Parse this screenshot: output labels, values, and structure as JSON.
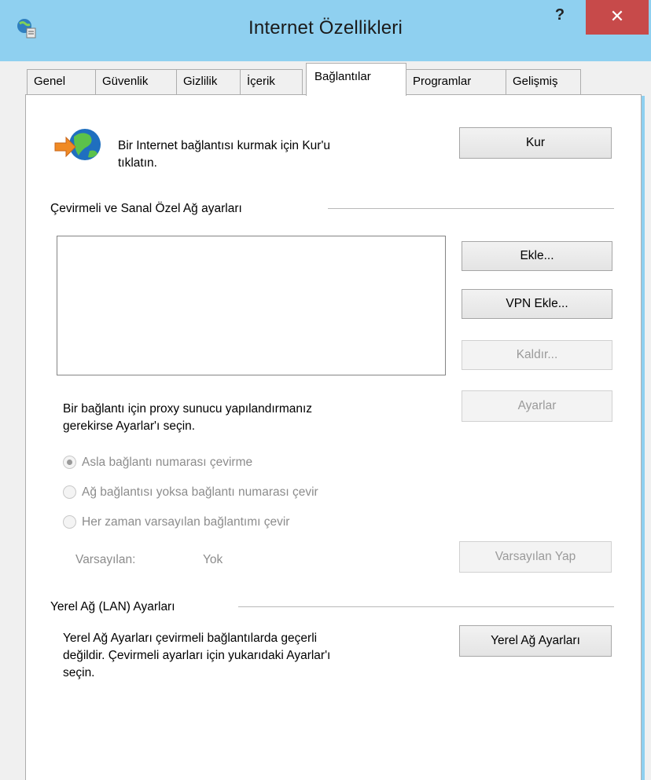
{
  "window": {
    "title": "Internet Özellikleri",
    "help_label": "?",
    "close_label": "✕"
  },
  "tabs": [
    {
      "label": "Genel"
    },
    {
      "label": "Güvenlik"
    },
    {
      "label": "Gizlilik"
    },
    {
      "label": "İçerik"
    },
    {
      "label": "Bağlantılar"
    },
    {
      "label": "Programlar"
    },
    {
      "label": "Gelişmiş"
    }
  ],
  "active_tab": "Bağlantılar",
  "setup": {
    "text_line1": "Bir Internet bağlantısı kurmak için Kur'u",
    "text_line2": "tıklatın.",
    "button_label": "Kur"
  },
  "dialup": {
    "group_label": "Çevirmeli ve Sanal Özel Ağ ayarları",
    "add_label": "Ekle...",
    "add_vpn_label": "VPN Ekle...",
    "remove_label": "Kaldır...",
    "proxy_text_line1": "Bir bağlantı için proxy sunucu yapılandırmanız",
    "proxy_text_line2": "gerekirse Ayarlar'ı seçin.",
    "settings_label": "Ayarlar",
    "radio_never": "Asla bağlantı numarası çevirme",
    "radio_when_no_network": "Ağ bağlantısı yoksa bağlantı numarası çevir",
    "radio_always": "Her zaman varsayılan bağlantımı çevir",
    "selected_radio": "radio_never",
    "default_label": "Varsayılan:",
    "default_value": "Yok",
    "set_default_label": "Varsayılan Yap"
  },
  "lan": {
    "group_label": "Yerel Ağ (LAN) Ayarları",
    "text_line1": "Yerel Ağ Ayarları çevirmeli bağlantılarda geçerli",
    "text_line2": "değildir. Çevirmeli ayarları için yukarıdaki Ayarlar'ı",
    "text_line3": "seçin.",
    "button_label": "Yerel Ağ Ayarları"
  },
  "colors": {
    "titlebar": "#8fd0f0",
    "close_button": "#c74a4a",
    "disabled_text": "#8c8c8c"
  }
}
